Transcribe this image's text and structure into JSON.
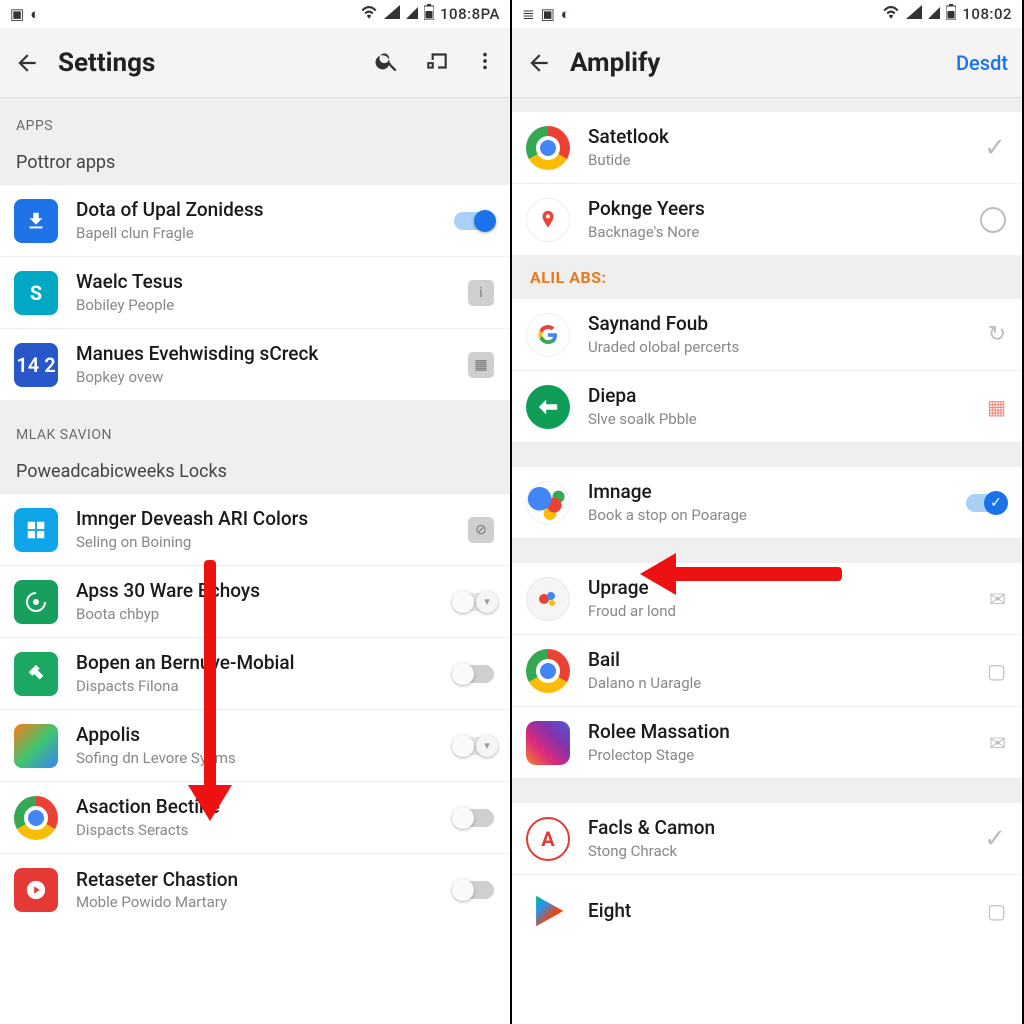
{
  "left": {
    "status": {
      "clock": "108:8PA"
    },
    "appbar": {
      "title": "Settings"
    },
    "section_apps_header": "APPS",
    "subheader_apps": "Pottror apps",
    "rows": [
      {
        "label": "Dota of Upal Zonidess",
        "sub": "Bapell clun Fragle"
      },
      {
        "label": "Waelc Tesus",
        "sub": "Bobiley People"
      },
      {
        "label": "Manues Evehwisding sCreck",
        "sub": "Bopkey ovew"
      }
    ],
    "section_lock_header": "MLAK SAVION",
    "subheader_lock": "Poweadcabicweeks Locks",
    "rows2": [
      {
        "label": "Imnger Deveash ARI Colors",
        "sub": "Seling on Boining"
      },
      {
        "label": "Apss 30 Ware Bchoys",
        "sub": "Boota chbyp"
      },
      {
        "label": "Bopen an Bernuve-Mobial",
        "sub": "Dispacts Filona"
      },
      {
        "label": "Appolis",
        "sub": "Sofing dn Levore Syems"
      },
      {
        "label": "Asaction Bectine",
        "sub": "Dispacts Seracts"
      },
      {
        "label": "Retaseter Chastion",
        "sub": "Moble Powido Martary"
      }
    ]
  },
  "right": {
    "status": {
      "clock": "108:02"
    },
    "appbar": {
      "title": "Amplify",
      "action": "Desdt"
    },
    "rows_top": [
      {
        "label": "Satetlook",
        "sub": "Butide"
      },
      {
        "label": "Poknge Yeers",
        "sub": "Backnage's Nore"
      }
    ],
    "orange_header": "ALIL ABS:",
    "rows_mid": [
      {
        "label": "Saynand Foub",
        "sub": "Uraded olobal percerts"
      },
      {
        "label": "Diepa",
        "sub": "Slve soalk Pbble"
      }
    ],
    "rows_img": [
      {
        "label": "Imnage",
        "sub": "Book a stop on Poarage"
      }
    ],
    "rows_btm": [
      {
        "label": "Uprage",
        "sub": "Froud ar lond"
      },
      {
        "label": "Bail",
        "sub": "Dalano n Uaragle"
      },
      {
        "label": "Rolee Massation",
        "sub": "Prolectop Stage"
      }
    ],
    "rows_last": [
      {
        "label": "Facls & Camon",
        "sub": "Stong Chrack"
      },
      {
        "label": "Eight",
        "sub": ""
      }
    ]
  }
}
